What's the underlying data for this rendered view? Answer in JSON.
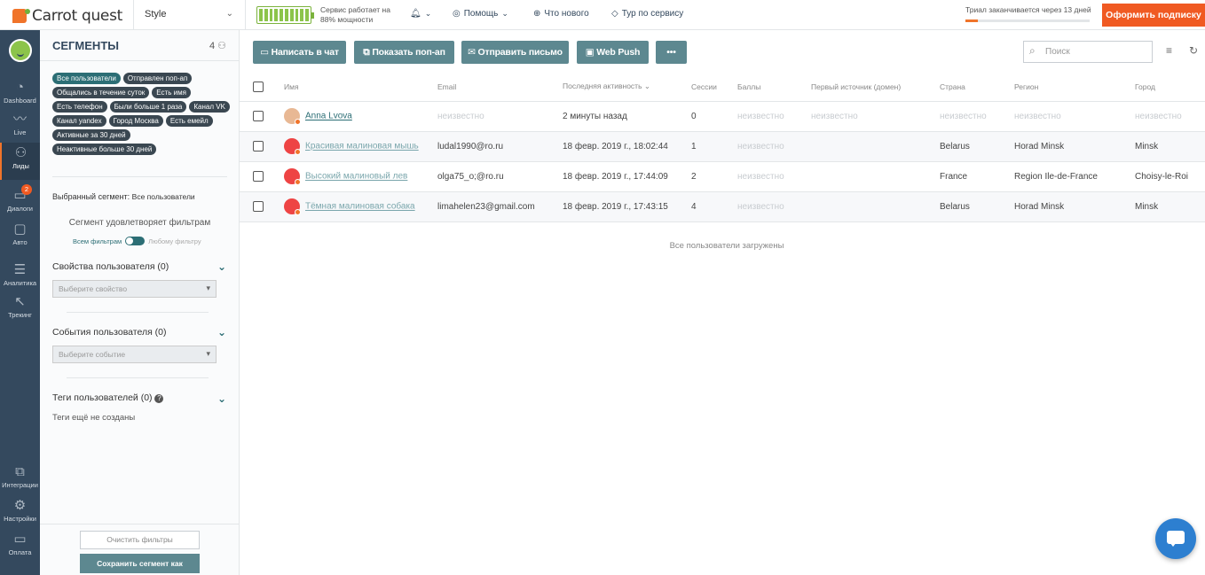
{
  "header": {
    "logo": "Carrot quest",
    "app_select": "Style",
    "service_status_line1": "Сервис работает на",
    "service_status_line2": "88% мощности",
    "nav": [
      "Помощь",
      "Что нового",
      "Тур по сервису"
    ],
    "trial_text": "Триал заканчивается через 13 дней",
    "trial_progress": 0.1,
    "subscribe": "Оформить подписку"
  },
  "rail": {
    "items": [
      {
        "label": "Dashboard"
      },
      {
        "label": "Live"
      },
      {
        "label": "Лиды"
      },
      {
        "label": "Диалоги",
        "badge": "2"
      },
      {
        "label": "Авто"
      },
      {
        "label": "Аналитика"
      },
      {
        "label": "Трекинг"
      },
      {
        "label": "Интеграции"
      },
      {
        "label": "Настройки"
      },
      {
        "label": "Оплата"
      }
    ]
  },
  "segments": {
    "title": "СЕГМЕНТЫ",
    "count": "4",
    "tags": [
      "Все пользователи",
      "Отправлен поп-ап",
      "Общались в течение суток",
      "Есть имя",
      "Есть телефон",
      "Были больше 1 раза",
      "Канал VK",
      "Канал yandex",
      "Город Москва",
      "Есть емейл",
      "Активные за 30 дней",
      "Неактивные больше 30 дней"
    ],
    "selected_label": "Выбранный сегмент:",
    "selected_value": "Все пользователи",
    "satisfies": "Сегмент удовлетворяет фильтрам",
    "toggle_all": "Всем фильтрам",
    "toggle_any": "Любому фильтру",
    "props_title": "Свойства пользователя (0)",
    "props_placeholder": "Выберите свойство",
    "events_title": "События пользователя (0)",
    "events_placeholder": "Выберите событие",
    "tags_title": "Теги пользователей (0)",
    "no_tags": "Теги ещё не созданы",
    "clear": "Очистить фильтры",
    "save": "Сохранить сегмент как"
  },
  "toolbar": {
    "chat": "Написать в чат",
    "popup": "Показать поп-ап",
    "email": "Отправить письмо",
    "push": "Web Push",
    "more": "•••",
    "search_placeholder": "Поиск"
  },
  "table": {
    "columns": [
      "Имя",
      "Email",
      "Последняя активность",
      "Сессии",
      "Баллы",
      "Первый источник (домен)",
      "Страна",
      "Регион",
      "Город"
    ],
    "rows": [
      {
        "name": "Anna Lvova",
        "email": "неизвестно",
        "last": "2 минуты назад",
        "sessions": "0",
        "score": "неизвестно",
        "source": "неизвестно",
        "country": "неизвестно",
        "region": "неизвестно",
        "city": "неизвестно"
      },
      {
        "name": "Красивая малиновая мышь",
        "email": "ludal1990@ro.ru",
        "last": "18 февр. 2019 г., 18:02:44",
        "sessions": "1",
        "score": "неизвестно",
        "source": "",
        "country": "Belarus",
        "region": "Horad Minsk",
        "city": "Minsk"
      },
      {
        "name": "Высокий малиновый лев",
        "email": "olga75_o;@ro.ru",
        "last": "18 февр. 2019 г., 17:44:09",
        "sessions": "2",
        "score": "неизвестно",
        "source": "",
        "country": "France",
        "region": "Region Ile-de-France",
        "city": "Choisy-le-Roi"
      },
      {
        "name": "Тёмная малиновая собака",
        "email": "limahelen23@gmail.com",
        "last": "18 февр. 2019 г., 17:43:15",
        "sessions": "4",
        "score": "неизвестно",
        "source": "",
        "country": "Belarus",
        "region": "Horad Minsk",
        "city": "Minsk"
      }
    ],
    "loaded": "Все пользователи загружены"
  }
}
